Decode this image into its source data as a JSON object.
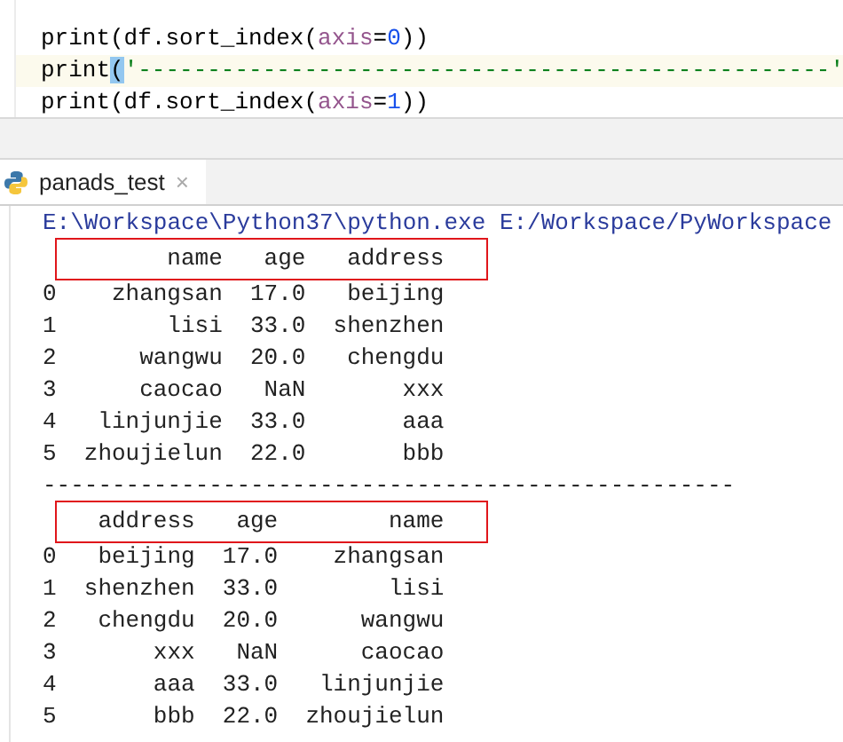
{
  "editor": {
    "lines": [
      {
        "current": false,
        "tokens": [
          {
            "kind": "plain",
            "text": "print(df.sort_index"
          },
          {
            "kind": "plain",
            "text": "("
          },
          {
            "kind": "param",
            "text": "axis"
          },
          {
            "kind": "plain",
            "text": "="
          },
          {
            "kind": "number",
            "text": "0"
          },
          {
            "kind": "plain",
            "text": "))"
          }
        ]
      },
      {
        "current": true,
        "tokens": [
          {
            "kind": "plain",
            "text": "print"
          },
          {
            "kind": "match",
            "text": "("
          },
          {
            "kind": "string",
            "text": "'--------------------------------------------------'"
          }
        ]
      },
      {
        "current": false,
        "tokens": [
          {
            "kind": "plain",
            "text": "print(df.sort_index"
          },
          {
            "kind": "plain",
            "text": "("
          },
          {
            "kind": "param",
            "text": "axis"
          },
          {
            "kind": "plain",
            "text": "="
          },
          {
            "kind": "number",
            "text": "1"
          },
          {
            "kind": "plain",
            "text": "))"
          }
        ]
      }
    ]
  },
  "run_tab": {
    "label": "panads_test",
    "close": "×",
    "selected": true
  },
  "console": {
    "command": "E:\\Workspace\\Python37\\python.exe E:/Workspace/PyWorkspace",
    "tables": [
      {
        "columns": [
          "name",
          "age",
          "address"
        ],
        "rows": [
          {
            "index": "0",
            "cells": [
              "zhangsan",
              "17.0",
              "beijing"
            ]
          },
          {
            "index": "1",
            "cells": [
              "lisi",
              "33.0",
              "shenzhen"
            ]
          },
          {
            "index": "2",
            "cells": [
              "wangwu",
              "20.0",
              "chengdu"
            ]
          },
          {
            "index": "3",
            "cells": [
              "caocao",
              "NaN",
              "xxx"
            ]
          },
          {
            "index": "4",
            "cells": [
              "linjunjie",
              "33.0",
              "aaa"
            ]
          },
          {
            "index": "5",
            "cells": [
              "zhoujielun",
              "22.0",
              "bbb"
            ]
          }
        ]
      },
      {
        "columns": [
          "address",
          "age",
          "name"
        ],
        "rows": [
          {
            "index": "0",
            "cells": [
              "beijing",
              "17.0",
              "zhangsan"
            ]
          },
          {
            "index": "1",
            "cells": [
              "shenzhen",
              "33.0",
              "lisi"
            ]
          },
          {
            "index": "2",
            "cells": [
              "chengdu",
              "20.0",
              "wangwu"
            ]
          },
          {
            "index": "3",
            "cells": [
              "xxx",
              "NaN",
              "caocao"
            ]
          },
          {
            "index": "4",
            "cells": [
              "aaa",
              "33.0",
              "linjunjie"
            ]
          },
          {
            "index": "5",
            "cells": [
              "bbb",
              "22.0",
              "zhoujielun"
            ]
          }
        ]
      }
    ],
    "separator": "--------------------------------------------------"
  }
}
